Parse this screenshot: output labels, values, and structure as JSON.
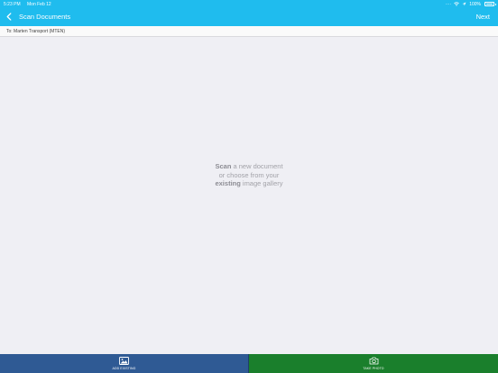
{
  "status_bar": {
    "time": "5:23 PM",
    "date": "Mon Feb 12",
    "signal": "····",
    "battery_percent": "100%"
  },
  "nav": {
    "back_icon": "chevron-left-icon",
    "title": "Scan Documents",
    "next_label": "Next"
  },
  "recipient": {
    "text": "To: Marten Transport (MTEN)"
  },
  "empty_state": {
    "scan_word": "Scan",
    "line1_rest": " a new document",
    "line2": "or choose from your",
    "existing_word": "existing",
    "line3_rest": " image gallery"
  },
  "actions": {
    "add_existing": {
      "label": "ADD EXISTING",
      "icon": "image-gallery-icon"
    },
    "take_photo": {
      "label": "TAKE PHOTO",
      "icon": "camera-icon"
    }
  },
  "colors": {
    "header": "#1fbcee",
    "add_existing_bg": "#2f5a94",
    "take_photo_bg": "#1a7f2c",
    "background": "#efeff4"
  }
}
